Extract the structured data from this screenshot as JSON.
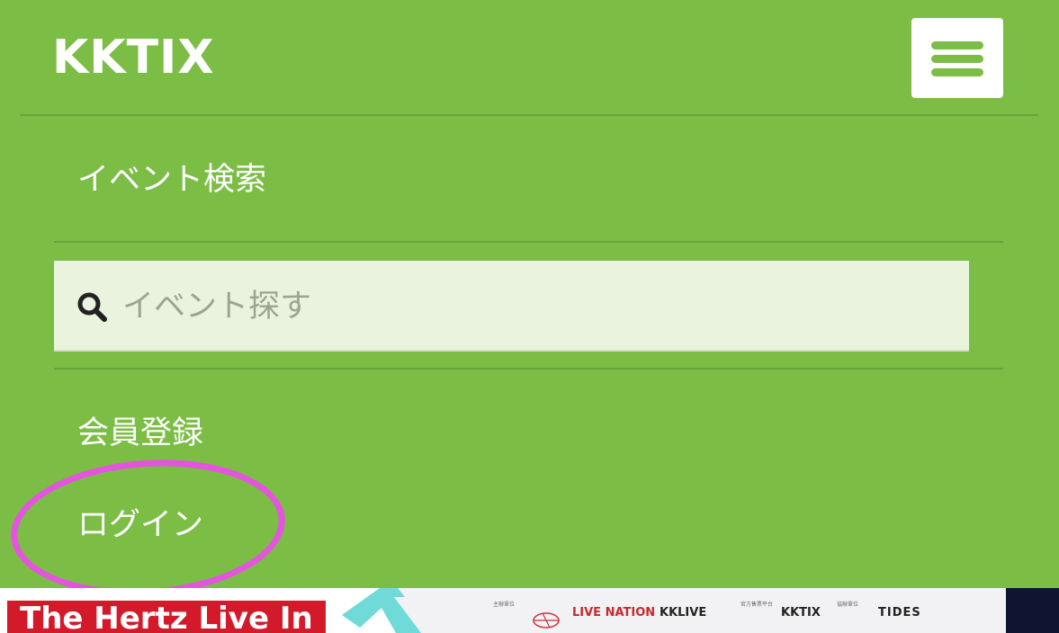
{
  "header": {
    "logo_text": "KKTIX",
    "menu_icon": "hamburger-menu-icon"
  },
  "nav": {
    "event_search_label": "イベント検索",
    "search": {
      "icon": "search-icon",
      "placeholder": "イベント探す",
      "value": ""
    },
    "register_label": "会員登録",
    "login_label": "ログイン"
  },
  "banner": {
    "title": "The Hertz Live In",
    "sponsors": [
      "LIVE NATION",
      "KKLIVE",
      "KKTIX",
      "TIDES"
    ]
  },
  "colors": {
    "brand_green": "#7bbd45",
    "highlight": "#e553e0",
    "search_bg": "#e9f3de"
  }
}
